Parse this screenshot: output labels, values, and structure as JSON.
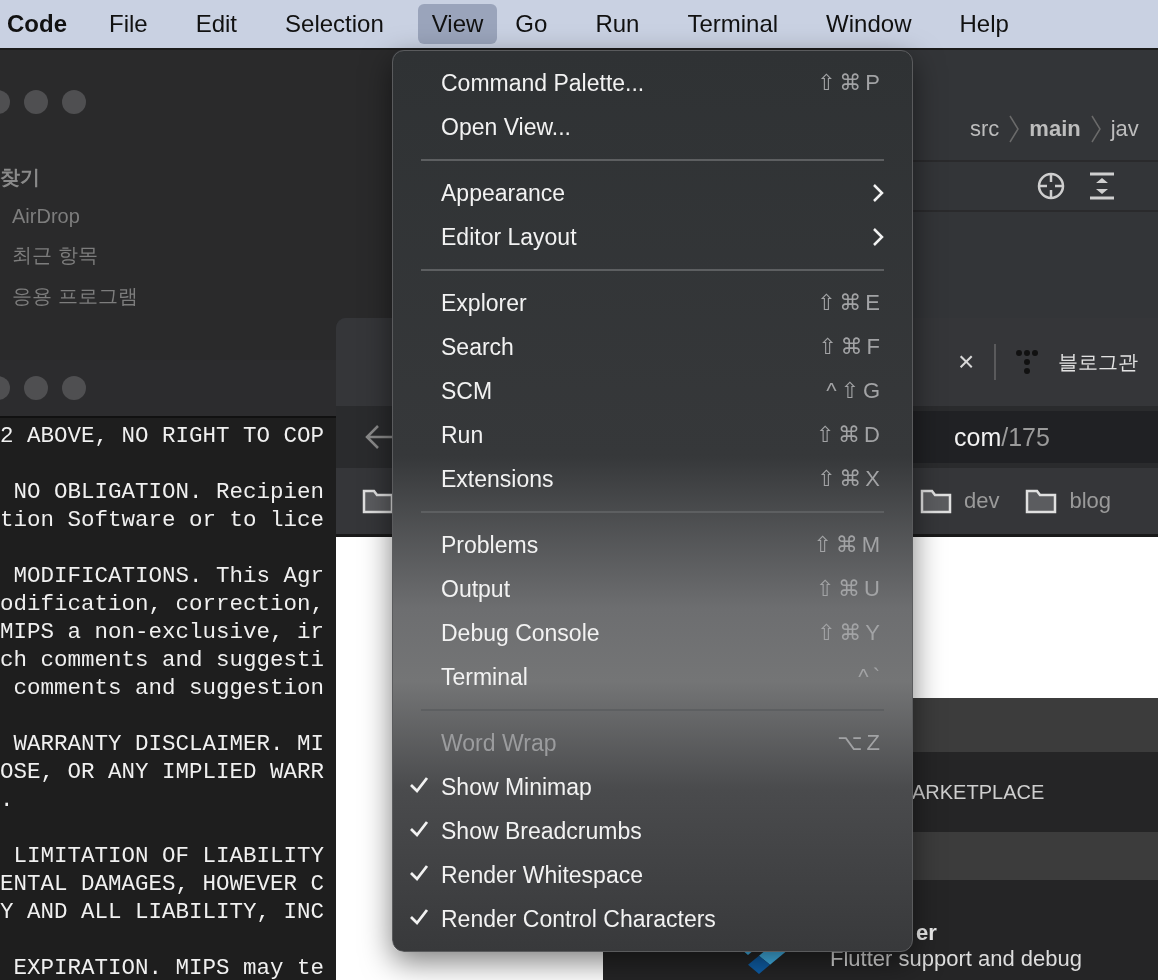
{
  "menubar": {
    "app": "Code",
    "items": [
      {
        "label": "File",
        "selected": false
      },
      {
        "label": "Edit",
        "selected": false
      },
      {
        "label": "Selection",
        "selected": false
      },
      {
        "label": "View",
        "selected": true
      },
      {
        "label": "Go",
        "selected": false
      },
      {
        "label": "Run",
        "selected": false
      },
      {
        "label": "Terminal",
        "selected": false
      },
      {
        "label": "Window",
        "selected": false
      },
      {
        "label": "Help",
        "selected": false
      }
    ]
  },
  "finder": {
    "heading": "찾기",
    "items": [
      "AirDrop",
      "최근 항목",
      "응용 프로그램"
    ]
  },
  "editor": {
    "breadcrumbs": [
      "src",
      "main",
      "jav"
    ]
  },
  "text_window": {
    "paragraphs": [
      [
        "2 ABOVE, NO RIGHT TO COP"
      ],
      [
        " NO OBLIGATION. Recipien",
        "tion Software or to lice"
      ],
      [
        " MODIFICATIONS. This Agr",
        "odification, correction,",
        "MIPS a non-exclusive, ir",
        "ch comments and suggesti",
        " comments and suggestion"
      ],
      [
        " WARRANTY DISCLAIMER. MI",
        "OSE, OR ANY IMPLIED WARR",
        "."
      ],
      [
        " LIMITATION OF LIABILITY",
        "ENTAL DAMAGES, HOWEVER C",
        "Y AND ALL LIABILITY, INC"
      ],
      [
        " EXPIRATION. MIPS may te"
      ]
    ]
  },
  "browser": {
    "tab_close": "×",
    "tab_title": "블로그관",
    "url": {
      "host": "com",
      "path": "/175"
    },
    "bookmarks": [
      "dev",
      "blog"
    ]
  },
  "extensions": {
    "section": "ARKETPLACE",
    "item": {
      "name": "er",
      "description": "Flutter support and debug"
    }
  },
  "menu": {
    "items": [
      {
        "kind": "item",
        "label": "Command Palette...",
        "shortcut": "⇧⌘P",
        "checked": false,
        "disabled": false
      },
      {
        "kind": "item",
        "label": "Open View...",
        "checked": false,
        "disabled": false
      },
      {
        "kind": "separator"
      },
      {
        "kind": "submenu",
        "label": "Appearance",
        "checked": false,
        "disabled": false
      },
      {
        "kind": "submenu",
        "label": "Editor Layout",
        "checked": false,
        "disabled": false
      },
      {
        "kind": "separator"
      },
      {
        "kind": "item",
        "label": "Explorer",
        "shortcut": "⇧⌘E",
        "checked": false,
        "disabled": false
      },
      {
        "kind": "item",
        "label": "Search",
        "shortcut": "⇧⌘F",
        "checked": false,
        "disabled": false
      },
      {
        "kind": "item",
        "label": "SCM",
        "shortcut": "^⇧G",
        "checked": false,
        "disabled": false
      },
      {
        "kind": "item",
        "label": "Run",
        "shortcut": "⇧⌘D",
        "checked": false,
        "disabled": false
      },
      {
        "kind": "item",
        "label": "Extensions",
        "shortcut": "⇧⌘X",
        "checked": false,
        "disabled": false
      },
      {
        "kind": "separator"
      },
      {
        "kind": "item",
        "label": "Problems",
        "shortcut": "⇧⌘M",
        "checked": false,
        "disabled": false
      },
      {
        "kind": "item",
        "label": "Output",
        "shortcut": "⇧⌘U",
        "checked": false,
        "disabled": false
      },
      {
        "kind": "item",
        "label": "Debug Console",
        "shortcut": "⇧⌘Y",
        "checked": false,
        "disabled": false
      },
      {
        "kind": "item",
        "label": "Terminal",
        "shortcut": "^`",
        "checked": false,
        "disabled": false
      },
      {
        "kind": "separator"
      },
      {
        "kind": "item",
        "label": "Word Wrap",
        "shortcut": "⌥Z",
        "checked": false,
        "disabled": true
      },
      {
        "kind": "item",
        "label": "Show Minimap",
        "checked": true,
        "disabled": false
      },
      {
        "kind": "item",
        "label": "Show Breadcrumbs",
        "checked": true,
        "disabled": false
      },
      {
        "kind": "item",
        "label": "Render Whitespace",
        "checked": true,
        "disabled": false
      },
      {
        "kind": "item",
        "label": "Render Control Characters",
        "checked": true,
        "disabled": false
      }
    ]
  }
}
